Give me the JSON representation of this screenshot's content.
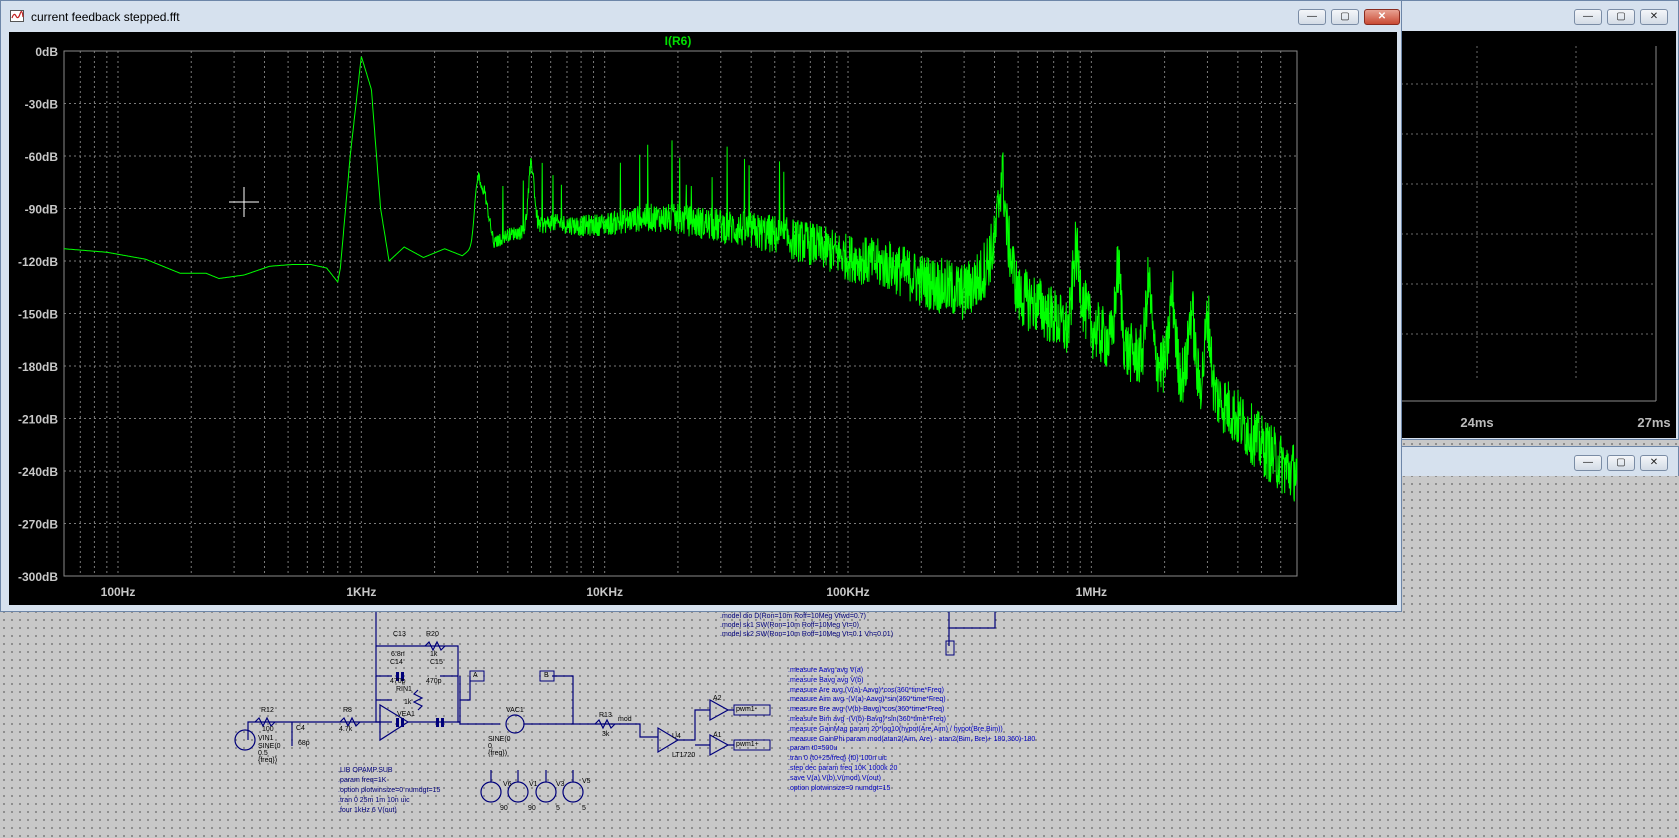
{
  "main_window": {
    "title": "current feedback stepped.fft",
    "trace_label": "I(R6)",
    "buttons": {
      "minimize": "—",
      "maximize": "▢",
      "close": "✕"
    }
  },
  "fft_axes": {
    "y_ticks": [
      "0dB",
      "-30dB",
      "-60dB",
      "-90dB",
      "-120dB",
      "-150dB",
      "-180dB",
      "-210dB",
      "-240dB",
      "-270dB",
      "-300dB"
    ],
    "x_ticks": [
      "100Hz",
      "1KHz",
      "10KHz",
      "100KHz",
      "1MHz"
    ]
  },
  "chart_data": {
    "type": "line",
    "title": "I(R6)",
    "x_scale": "log",
    "xlim": [
      60,
      7000000
    ],
    "ylim": [
      -300,
      0
    ],
    "grid": true,
    "legend": "top-center",
    "color": "#00ff00",
    "series": [
      {
        "name": "I(R6)",
        "x": [
          60,
          90,
          130,
          180,
          230,
          260,
          330,
          420,
          520,
          620,
          720,
          800,
          820,
          900,
          1000,
          1100,
          1200,
          1300,
          1500,
          1800,
          2200,
          2600,
          3000,
          3200,
          3500,
          4000,
          5000,
          6000,
          8000,
          10000,
          15000,
          20000,
          30000,
          50000,
          70000,
          100000,
          150000,
          200000,
          250000,
          300000,
          350000,
          400000,
          430000,
          450000,
          500000,
          600000,
          700000,
          800000,
          900000,
          1000000,
          1300000,
          1600000,
          2000000,
          2600000,
          3300000,
          4000000,
          5000000,
          6500000
        ],
        "y": [
          -113,
          -115,
          -119,
          -127,
          -127,
          -130,
          -128,
          -123,
          -122,
          -122,
          -124,
          -132,
          -124,
          -60,
          -3,
          -22,
          -90,
          -120,
          -112,
          -118,
          -113,
          -117,
          -110,
          -80,
          -110,
          -105,
          -102,
          -98,
          -100,
          -99,
          -95,
          -96,
          -100,
          -105,
          -110,
          -118,
          -123,
          -131,
          -135,
          -138,
          -130,
          -110,
          -75,
          -105,
          -140,
          -145,
          -152,
          -160,
          -140,
          -158,
          -170,
          -175,
          -180,
          -188,
          -198,
          -210,
          -225,
          -240
        ]
      }
    ],
    "peaks": [
      {
        "x": 1000,
        "y": -3
      },
      {
        "x": 3000,
        "y": -75
      },
      {
        "x": 5000,
        "y": -65
      },
      {
        "x": 430000,
        "y": -68
      },
      {
        "x": 860000,
        "y": -115
      },
      {
        "x": 1290000,
        "y": -125
      },
      {
        "x": 1720000,
        "y": -133
      },
      {
        "x": 2150000,
        "y": -140
      },
      {
        "x": 2580000,
        "y": -148
      },
      {
        "x": 3010000,
        "y": -153
      }
    ]
  },
  "second_window": {
    "x_ticks": [
      "24ms",
      "27ms"
    ],
    "buttons": {
      "minimize": "—",
      "maximize": "▢",
      "close": "✕"
    }
  },
  "third_window": {
    "buttons": {
      "minimize": "—",
      "maximize": "▢",
      "close": "✕"
    }
  },
  "schematic": {
    "model_lines": [
      ".model dio D(Ron=10m Roff=10Meg Vfwd=0.7)",
      ".model sk1 SW(Ron=10m Roff=10Meg Vt=0)",
      ".model sk2 SW(Ron=10m Roff=10Meg Vt=0.1 Vh=0.01)"
    ],
    "measure_lines": [
      ".measure Aavg avg V(a)",
      ".measure Bavg avg V(b)",
      ".measure Are avg (V(a)-Aavg)*cos(360*time*Freq)",
      ".measure Aim avg -(V(a)-Aavg)*sin(360*time*Freq)",
      ".measure Bre avg (V(b)-Bavg)*cos(360*time*Freq)",
      ".measure Bim avg -(V(b)-Bavg)*sin(360*time*Freq)",
      ".measure GainMag param 20*log10(hypot(Are,Aim) / hypot(Bre,Bim))",
      ".measure GainPhi param mod(atan2(Aim, Are) - atan2(Bim, Bre)+ 180,360)-180",
      ".param t0=500u",
      ".tran 0 {t0+25/freq} {t0} 100n uic",
      ".step dec param freq 10K 1000k 20",
      ".save V(a) V(b) V(mod) V(out)",
      ".option plotwinsize=0 numdgt=15"
    ],
    "sub_lines": [
      ".LIB OPAMP.SUB",
      ".param freq=1K",
      ".option plotwinsize=0 numdgt=15",
      ".tran 0 25m 1m 10n uic",
      ".four 1kHz 6 V(out)"
    ],
    "labels": {
      "c13": "C13",
      "c13v": "6.8n",
      "r20": "R20",
      "r20v": "1k",
      "c14": "C14",
      "c14v": "470p",
      "c15": "C15",
      "c15v": "470p",
      "rin1": "RIN1",
      "rin1v": "1k",
      "vea1": "VEA1",
      "r12": "R12",
      "r12v": "100",
      "vin1": "VIN1",
      "vin1v": "SINE(0 0.5 {freq})",
      "c4": "C4",
      "c4v": "68p",
      "r8": "R8",
      "r8v": "4.7k",
      "vac1": "VAC1",
      "vac1v": "SINE(0 0 {freq})",
      "r13": "R13",
      "r13v": "3k",
      "mod": "mod",
      "u4": "U4",
      "u4v": "LT1720",
      "a2": "A2",
      "a1": "A1",
      "pwm1n": "pwm1-",
      "pwm1p": "pwm1+",
      "a_flag": "A",
      "b_flag": "B",
      "v6": "V6",
      "v6v": "90",
      "v1": "V1",
      "v1v": "90",
      "v3": "V3",
      "v3v": "5",
      "v5": "V5",
      "v5v": "5"
    }
  }
}
